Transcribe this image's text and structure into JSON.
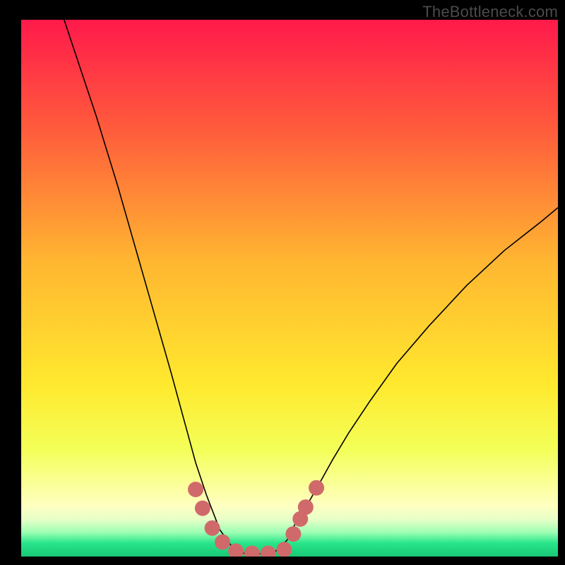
{
  "watermark": "TheBottleneck.com",
  "chart_data": {
    "type": "line",
    "title": "",
    "xlabel": "",
    "ylabel": "",
    "xlim": [
      0,
      100
    ],
    "ylim": [
      0,
      100
    ],
    "gradient_stops": [
      {
        "offset": 0.0,
        "color": "#ff1a4b"
      },
      {
        "offset": 0.2,
        "color": "#ff5a3c"
      },
      {
        "offset": 0.45,
        "color": "#ffb631"
      },
      {
        "offset": 0.68,
        "color": "#ffe92e"
      },
      {
        "offset": 0.8,
        "color": "#f3ff57"
      },
      {
        "offset": 0.905,
        "color": "#ffffc0"
      },
      {
        "offset": 0.93,
        "color": "#e8ffc8"
      },
      {
        "offset": 0.955,
        "color": "#9dffb4"
      },
      {
        "offset": 0.975,
        "color": "#28e58a"
      },
      {
        "offset": 1.0,
        "color": "#19c877"
      }
    ],
    "series": [
      {
        "name": "curve",
        "color": "#000000",
        "x": [
          8,
          10,
          12,
          14,
          16,
          18,
          20,
          22,
          24,
          26,
          28,
          29.5,
          31,
          32.5,
          34.5,
          37,
          40,
          42.5,
          44,
          47,
          49.5,
          51,
          53.5,
          55.5,
          58,
          61,
          65,
          70,
          76,
          83,
          90,
          97,
          100
        ],
        "y": [
          100,
          94,
          88,
          82,
          75.5,
          69,
          62,
          55,
          48,
          41,
          34,
          28.5,
          23,
          17.5,
          11.5,
          5,
          0.8,
          0.5,
          0.5,
          0.6,
          3,
          6,
          10,
          13.5,
          18,
          23,
          29,
          36,
          43,
          50.5,
          57,
          62.5,
          65
        ]
      }
    ],
    "markers": {
      "color": "#d06a6a",
      "size": 11,
      "points": [
        {
          "x": 32.5,
          "y": 12.5
        },
        {
          "x": 33.8,
          "y": 9.0
        },
        {
          "x": 35.6,
          "y": 5.3
        },
        {
          "x": 37.5,
          "y": 2.7
        },
        {
          "x": 40.0,
          "y": 1.0
        },
        {
          "x": 43.0,
          "y": 0.6
        },
        {
          "x": 46.0,
          "y": 0.6
        },
        {
          "x": 49.0,
          "y": 1.3
        },
        {
          "x": 50.7,
          "y": 4.2
        },
        {
          "x": 52.0,
          "y": 7.0
        },
        {
          "x": 53.0,
          "y": 9.2
        },
        {
          "x": 55.0,
          "y": 12.8
        }
      ]
    }
  }
}
